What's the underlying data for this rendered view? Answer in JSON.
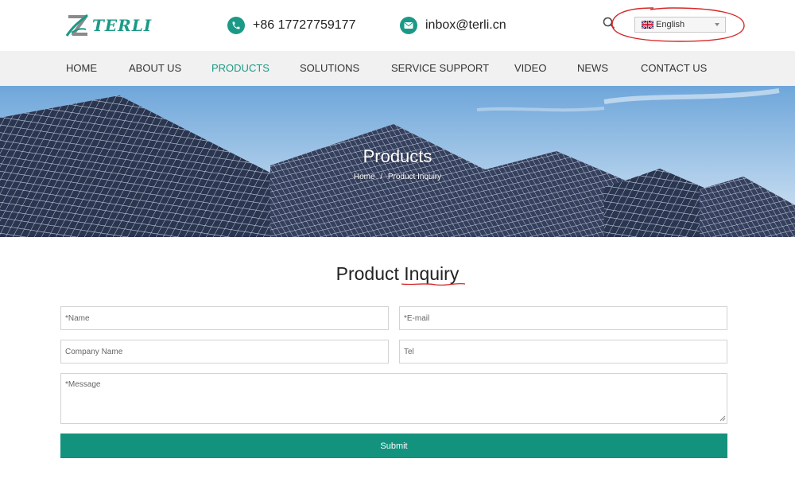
{
  "brand": {
    "logo_text": "TERLI",
    "accent": "#1a9a86"
  },
  "contacts": {
    "phone": {
      "icon": "phone-icon",
      "text": "+86 17727759177"
    },
    "email": {
      "icon": "mail-icon",
      "text": "inbox@terli.cn"
    }
  },
  "header": {
    "search_icon": "search-icon",
    "language": {
      "selected": "English",
      "flag_icon": "uk-flag-icon"
    }
  },
  "nav": {
    "items": [
      {
        "label": "HOME",
        "active": false
      },
      {
        "label": "ABOUT US",
        "active": false
      },
      {
        "label": "PRODUCTS",
        "active": true
      },
      {
        "label": "SOLUTIONS",
        "active": false
      },
      {
        "label": "SERVICE SUPPORT",
        "active": false
      },
      {
        "label": "VIDEO",
        "active": false
      },
      {
        "label": "NEWS",
        "active": false
      },
      {
        "label": "CONTACT US",
        "active": false
      }
    ]
  },
  "banner": {
    "title": "Products",
    "breadcrumb": {
      "home": "Home",
      "separator": "/",
      "current": "Product Inquiry"
    }
  },
  "inquiry": {
    "title": "Product Inquiry",
    "fields": {
      "name": {
        "placeholder": "*Name",
        "value": ""
      },
      "email": {
        "placeholder": "*E-mail",
        "value": ""
      },
      "company": {
        "placeholder": "Company Name",
        "value": ""
      },
      "tel": {
        "placeholder": "Tel",
        "value": ""
      },
      "message": {
        "placeholder": "*Message",
        "value": ""
      }
    },
    "submit_label": "Submit",
    "submit_color": "#13927e"
  }
}
